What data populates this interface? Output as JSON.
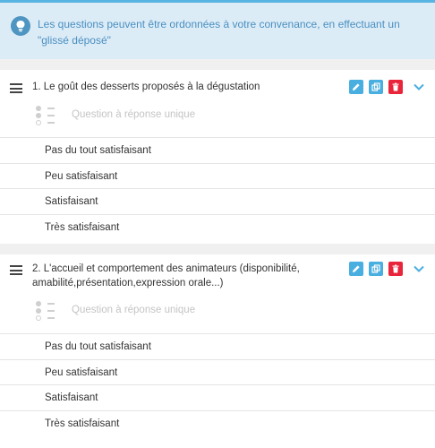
{
  "info": {
    "text": "Les questions peuvent être ordonnées à votre convenance, en effectuant un \"glissé déposé\""
  },
  "questions": [
    {
      "title": "1. Le goût des desserts proposés à la dégustation",
      "type_label": "Question à réponse unique",
      "choices": [
        "Pas du tout satisfaisant",
        "Peu satisfaisant",
        "Satisfaisant",
        "Très satisfaisant"
      ]
    },
    {
      "title": "2. L'accueil et comportement des animateurs (disponibilité, amabilité,présentation,expression orale...)",
      "type_label": "Question à réponse unique",
      "choices": [
        "Pas du tout satisfaisant",
        "Peu satisfaisant",
        "Satisfaisant",
        "Très satisfaisant"
      ]
    }
  ],
  "colors": {
    "banner_bg": "#dcecf7",
    "banner_text": "#4a8fc0",
    "accent_blue": "#49aee0",
    "delete_red": "#e8253a"
  },
  "icons": {
    "info": "lightbulb-icon",
    "drag": "drag-handle-icon",
    "edit": "pencil-icon",
    "copy": "copy-icon",
    "delete": "trash-icon",
    "expand": "chevron-down-icon",
    "type": "radio-list-icon"
  }
}
